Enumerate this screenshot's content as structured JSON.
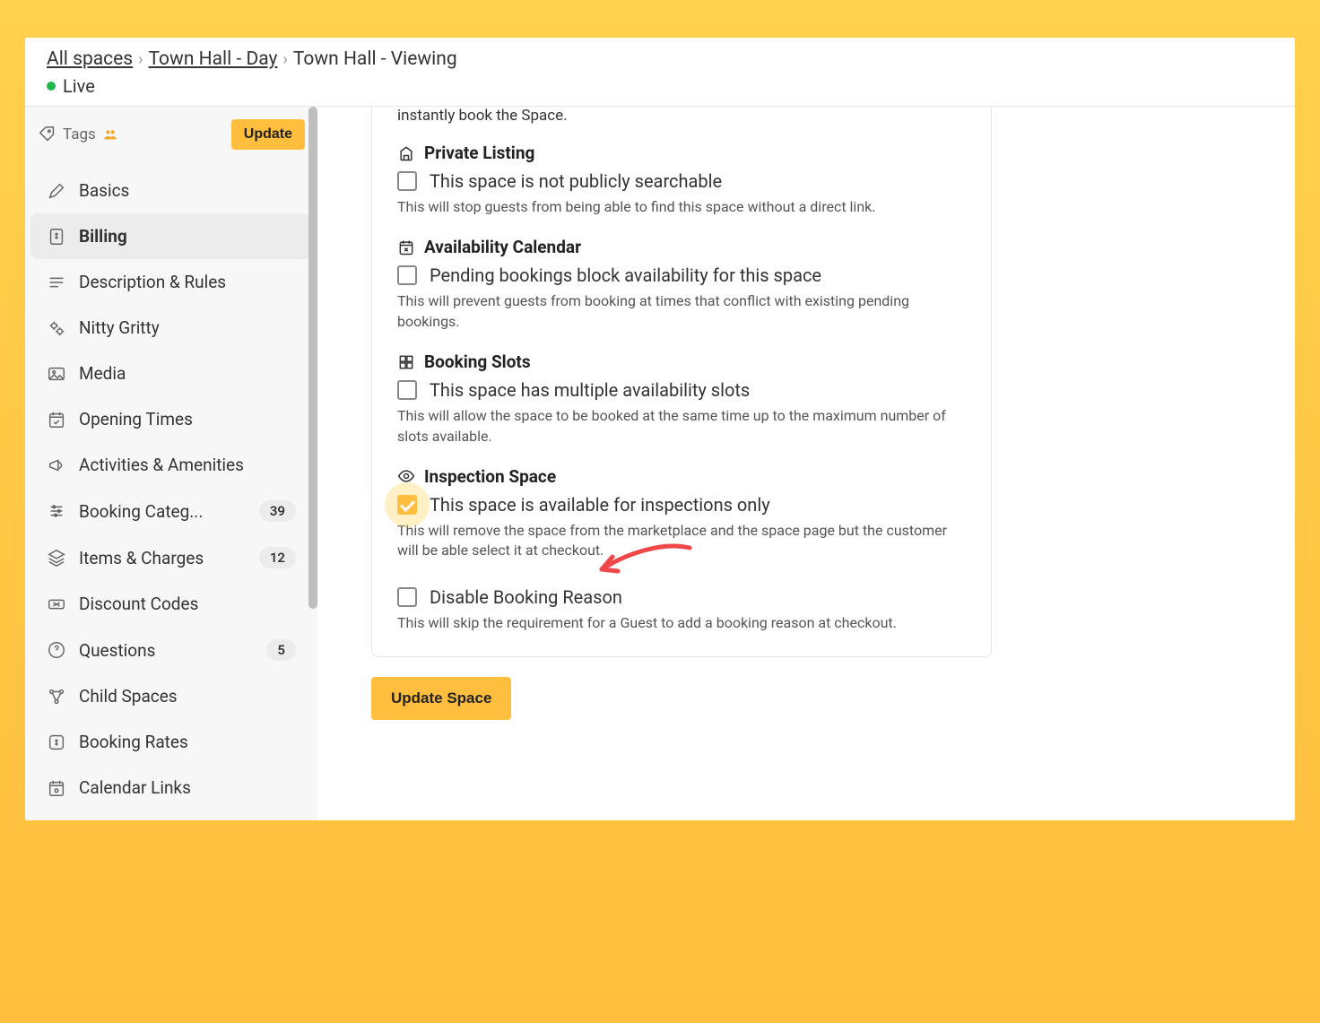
{
  "breadcrumb": {
    "root": "All spaces",
    "parent": "Town Hall - Day ",
    "current": "Town Hall - Viewing"
  },
  "status": {
    "label": "Live"
  },
  "sidebar": {
    "tags_label": "Tags",
    "update_label": "Update",
    "items": [
      {
        "label": "Basics",
        "badge": null
      },
      {
        "label": "Billing",
        "badge": null,
        "active": true
      },
      {
        "label": "Description & Rules",
        "badge": null
      },
      {
        "label": "Nitty Gritty",
        "badge": null
      },
      {
        "label": "Media",
        "badge": null
      },
      {
        "label": "Opening Times",
        "badge": null
      },
      {
        "label": "Activities & Amenities",
        "badge": null
      },
      {
        "label": "Booking Categ...",
        "badge": "39"
      },
      {
        "label": "Items & Charges",
        "badge": "12"
      },
      {
        "label": "Discount Codes",
        "badge": null
      },
      {
        "label": "Questions",
        "badge": "5"
      },
      {
        "label": "Child Spaces",
        "badge": null
      },
      {
        "label": "Booking Rates",
        "badge": null
      },
      {
        "label": "Calendar Links",
        "badge": null
      }
    ]
  },
  "main": {
    "intro_fragment": "instantly book the Space.",
    "sections": [
      {
        "title": "Private Listing",
        "option": "This space is not publicly searchable",
        "checked": false,
        "desc": "This will stop guests from being able to find this space without a direct link."
      },
      {
        "title": "Availability Calendar",
        "option": "Pending bookings block availability for this space",
        "checked": false,
        "desc": "This will prevent guests from booking at times that conflict with existing pending bookings."
      },
      {
        "title": "Booking Slots",
        "option": "This space has multiple availability slots",
        "checked": false,
        "desc": "This will allow the space to be booked at the same time up to the maximum number of slots available."
      },
      {
        "title": "Inspection Space",
        "option": "This space is available for inspections only",
        "checked": true,
        "desc": "This will remove the space from the marketplace and the space page but the customer will be able select it at checkout."
      },
      {
        "title": "Disable Booking Reason",
        "option": "Disable Booking Reason",
        "checked": false,
        "hide_title": true,
        "desc": "This will skip the requirement for a Guest to add a booking reason at checkout."
      }
    ],
    "update_button": "Update Space"
  }
}
